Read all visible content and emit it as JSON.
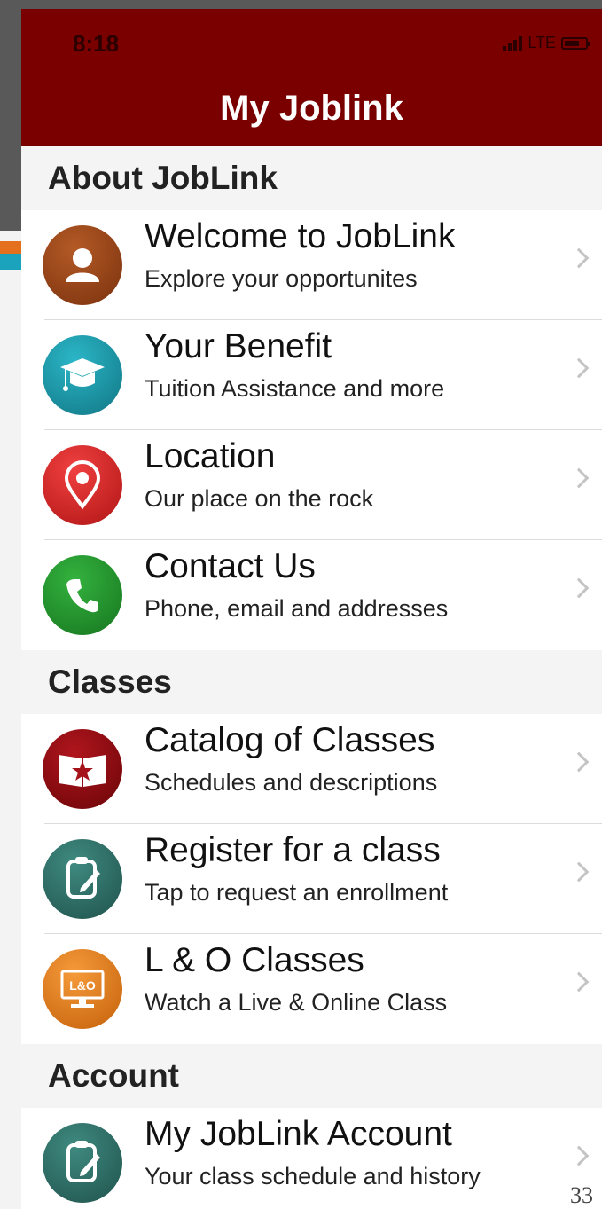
{
  "status_bar": {
    "time": "8:18",
    "network": "LTE"
  },
  "app_title": "My Joblink",
  "sections": [
    {
      "header": "About JobLink",
      "items": [
        {
          "title": "Welcome to JobLink",
          "subtitle": "Explore your opportunites",
          "icon": "user-icon",
          "color": "#8a3d14"
        },
        {
          "title": "Your Benefit",
          "subtitle": "Tuition Assistance and more",
          "icon": "graduation-cap-icon",
          "color": "#1b93a6"
        },
        {
          "title": "Location",
          "subtitle": "Our place on the rock",
          "icon": "map-pin-icon",
          "color": "#d42626"
        },
        {
          "title": "Contact Us",
          "subtitle": "Phone, email and addresses",
          "icon": "phone-icon",
          "color": "#1e8f2a"
        }
      ]
    },
    {
      "header": "Classes",
      "items": [
        {
          "title": "Catalog of Classes",
          "subtitle": "Schedules and descriptions",
          "icon": "book-star-icon",
          "color": "#8e0a10"
        },
        {
          "title": "Register for a class",
          "subtitle": "Tap to request an enrollment",
          "icon": "clipboard-pen-icon",
          "color": "#2f6e66"
        },
        {
          "title": "L & O Classes",
          "subtitle": "Watch a Live & Online Class",
          "icon": "monitor-icon",
          "icon_text": "L&O",
          "color": "#e77a17"
        }
      ]
    },
    {
      "header": "Account",
      "items": [
        {
          "title": "My JobLink Account",
          "subtitle": "Your class schedule and history",
          "icon": "clipboard-pen-icon",
          "color": "#2f6e66"
        }
      ]
    }
  ],
  "page_number": "33"
}
